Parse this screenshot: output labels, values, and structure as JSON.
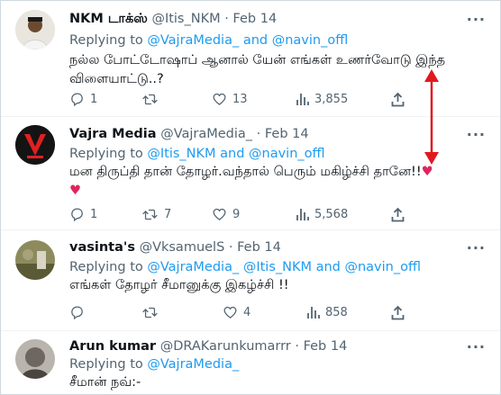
{
  "tweets": [
    {
      "name": "NKM டாக்ஸ்",
      "handle": "@Itis_NKM",
      "date": "· Feb 14",
      "reply_prefix": "Replying to",
      "reply_to": "@VajraMedia_  and @navin_offl",
      "text_lines": [
        "நல்ல போட்டோஷாப் ஆனால் யேன் எங்கள் உணர்வோடு இந்த",
        "விளையாட்டு..?"
      ],
      "replies": "1",
      "retweets": "",
      "likes": "13",
      "views": "3,855"
    },
    {
      "name": "Vajra Media",
      "handle": "@VajraMedia_",
      "date": "· Feb 14",
      "reply_prefix": "Replying to",
      "reply_to": "@Itis_NKM and @navin_offl",
      "text_lines": [
        "மன திருப்தி தான் தோழர்.வந்தால் பெரும் மகிழ்ச்சி தானே!!"
      ],
      "replies": "1",
      "retweets": "7",
      "likes": "9",
      "views": "5,568"
    },
    {
      "name": "vasinta's",
      "handle": "@VksamuelS",
      "date": "· Feb 14",
      "reply_prefix": "Replying to",
      "reply_to": "@VajraMedia_ @Itis_NKM and @navin_offl",
      "text_lines": [
        "எங்கள் தோழர் சீமானுக்கு இகழ்ச்சி !!"
      ],
      "replies": "",
      "retweets": "",
      "likes": "4",
      "views": "858"
    },
    {
      "name": "Arun kumar",
      "handle": "@DRAKarunkumarrr",
      "date": "· Feb 14",
      "reply_prefix": "Replying to",
      "reply_to": "@VajraMedia_",
      "text_lines": [
        "சீமான் நவ்:-"
      ]
    }
  ],
  "more_label": "···",
  "colors": {
    "accent": "#1d9bf0",
    "muted": "#536471",
    "annotation": "#e0191e",
    "heart": "#e0245e"
  },
  "icons": [
    "reply-icon",
    "retweet-icon",
    "like-icon",
    "views-icon",
    "share-icon",
    "more-icon",
    "heart-emoji-icon"
  ]
}
